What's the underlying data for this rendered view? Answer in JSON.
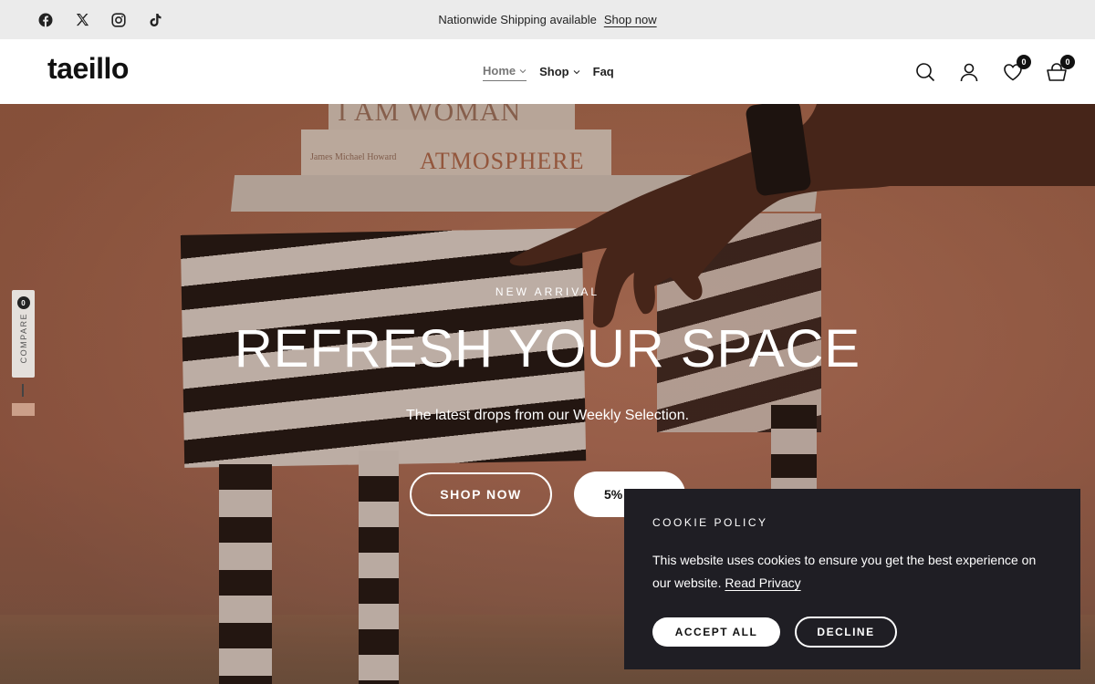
{
  "announcement": {
    "text": "Nationwide Shipping available",
    "link": "Shop now",
    "socials": [
      "facebook-icon",
      "x-icon",
      "instagram-icon",
      "tiktok-icon"
    ]
  },
  "header": {
    "logo": "taeillo",
    "nav": [
      {
        "label": "Home",
        "dropdown": true,
        "active": true
      },
      {
        "label": "Shop",
        "dropdown": true,
        "active": false
      },
      {
        "label": "Faq",
        "dropdown": false,
        "active": false
      }
    ],
    "icons": [
      "search-icon",
      "account-icon",
      "wishlist-icon",
      "cart-icon"
    ],
    "wishlist_count": "0",
    "cart_count": "0"
  },
  "hero": {
    "eyebrow": "NEW ARRIVAL",
    "headline": "REFRESH YOUR SPACE",
    "subline": "The latest drops from our Weekly Selection.",
    "primary_button": "SHOP NOW",
    "secondary_button": "5%",
    "image_text": {
      "book_top": "I AM WOMAN",
      "book_title": "ATMOSPHERE",
      "book_author": "James Michael Howard"
    }
  },
  "compare": {
    "label": "COMPARE",
    "count": "0"
  },
  "cookie": {
    "title": "COOKIE POLICY",
    "body": "This website uses cookies to ensure you get the best experience on our website.",
    "link": "Read Privacy",
    "accept": "ACCEPT ALL",
    "decline": "DECLINE"
  },
  "colors": {
    "hero_bg": "#b97457",
    "cookie_bg": "#1f1e24",
    "announcement_bg": "#ebebeb"
  }
}
